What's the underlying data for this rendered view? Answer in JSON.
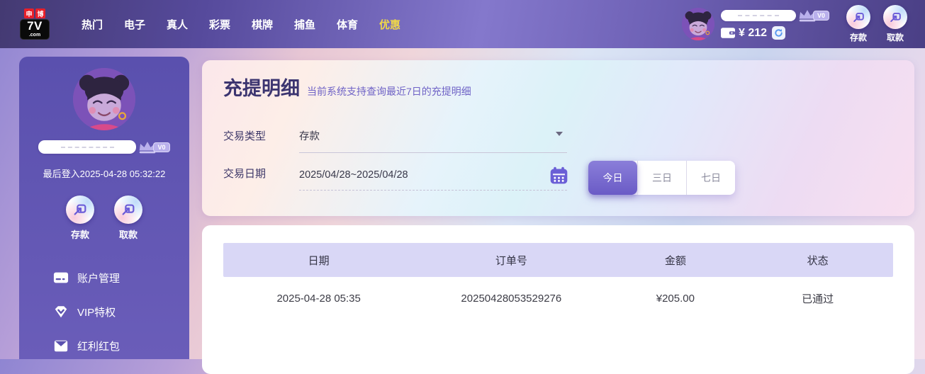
{
  "navbar": {
    "logo": {
      "badge_left": "申",
      "badge_right": "博",
      "name": "7V",
      "tld": ".com"
    },
    "menu": [
      {
        "label": "热门"
      },
      {
        "label": "电子"
      },
      {
        "label": "真人"
      },
      {
        "label": "彩票"
      },
      {
        "label": "棋牌"
      },
      {
        "label": "捕鱼"
      },
      {
        "label": "体育"
      },
      {
        "label": "优惠"
      }
    ],
    "user": {
      "vip_level": "V0",
      "balance": "¥ 212"
    },
    "deposit_label": "存款",
    "withdraw_label": "取款"
  },
  "sidebar": {
    "vip_level": "V0",
    "last_login": "最后登入2025-04-28 05:32:22",
    "deposit_label": "存款",
    "withdraw_label": "取款",
    "menu": [
      {
        "label": "账户管理",
        "icon": "bank-card-icon"
      },
      {
        "label": "VIP特权",
        "icon": "vip-diamond-icon"
      },
      {
        "label": "红利红包",
        "icon": "red-packet-icon"
      }
    ]
  },
  "main": {
    "title": "充提明细",
    "subtitle": "当前系统支持查询最近7日的充提明细",
    "form": {
      "type_label": "交易类型",
      "type_value": "存款",
      "date_label": "交易日期",
      "date_value": "2025/04/28~2025/04/28"
    },
    "ranges": [
      {
        "label": "今日",
        "active": true
      },
      {
        "label": "三日",
        "active": false
      },
      {
        "label": "七日",
        "active": false
      }
    ],
    "table": {
      "headers": [
        "日期",
        "订单号",
        "金额",
        "状态"
      ],
      "rows": [
        [
          "2025-04-28 05:35",
          "20250428053529276",
          "¥205.00",
          "已通过"
        ]
      ]
    }
  },
  "colors": {
    "accent_purple": "#6a5fd6",
    "nav_active_yellow": "#f0d848",
    "sidebar_purple": "#5b51af",
    "table_header_bg": "#d9d7f6",
    "selected_range_bg": "#6a5bc6"
  }
}
